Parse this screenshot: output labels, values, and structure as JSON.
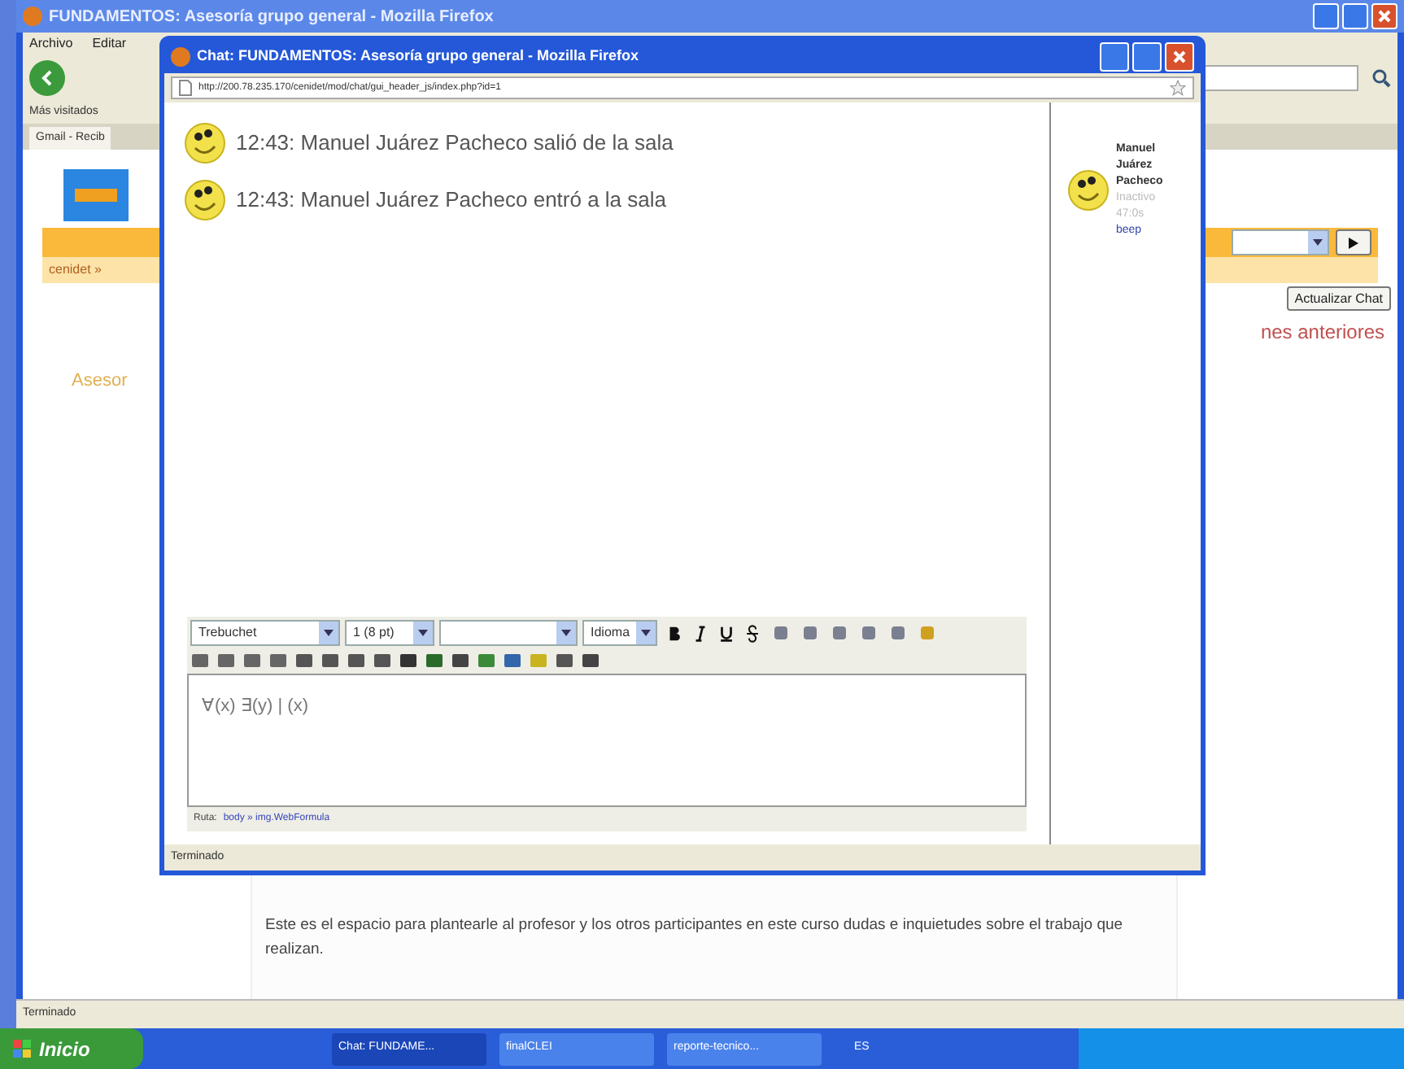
{
  "main_window": {
    "title": "FUNDAMENTOS: Asesoría grupo general - Mozilla Firefox",
    "menu": [
      "Archivo",
      "Editar"
    ],
    "bookmarks": [
      "Más visitados"
    ],
    "tabs": [
      {
        "label": "Gmail - Recib",
        "selected": true
      }
    ],
    "breadcrumb": "cenidet »",
    "heading": "Asesor",
    "update_button": "Actualizar Chat",
    "link": "nes anteriores",
    "description": "Este es el espacio para plantearle al profesor y los otros participantes en este curso dudas e inquietudes sobre el trabajo que realizan.",
    "status_bar": "Terminado"
  },
  "chat_window": {
    "title": "Chat: FUNDAMENTOS: Asesoría grupo general - Mozilla Firefox",
    "url": "http://200.78.235.170/cenidet/mod/chat/gui_header_js/index.php?id=1",
    "messages": [
      {
        "text": "12:43: Manuel Juárez Pacheco salió de la sala"
      },
      {
        "text": "12:43: Manuel Juárez Pacheco entró a la sala"
      }
    ],
    "users": [
      {
        "name": "Manuel Juárez Pacheco",
        "idle": "Inactivo 47:0s",
        "action": "beep"
      }
    ],
    "editor": {
      "font": "Trebuchet",
      "size": "1 (8 pt)",
      "language": "Idioma",
      "content": "∀(x) ∃(y) | (x)",
      "path_label": "Ruta:",
      "path": "body » img.WebFormula"
    },
    "status_bar": "Terminado"
  },
  "taskbar": {
    "start": "Inicio",
    "tasks": [
      {
        "label": "Chat: FUNDAME...",
        "selected": true
      },
      {
        "label": "finalCLEI",
        "selected": false
      },
      {
        "label": "reporte-tecnico...",
        "selected": false
      }
    ],
    "language": "ES"
  }
}
